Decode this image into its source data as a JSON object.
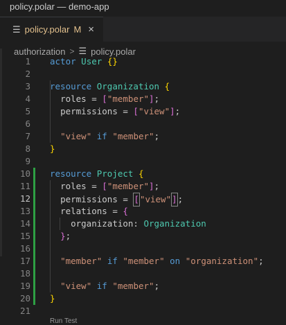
{
  "window": {
    "title": "policy.polar — demo-app"
  },
  "tab": {
    "filename": "policy.polar",
    "modified": "M",
    "close": "×"
  },
  "breadcrumb": {
    "folder": "authorization",
    "file": "policy.polar"
  },
  "editor": {
    "active_line": 12,
    "line_numbers": [
      "1",
      "2",
      "3",
      "4",
      "5",
      "6",
      "7",
      "8",
      "9",
      "10",
      "11",
      "12",
      "13",
      "14",
      "15",
      "16",
      "17",
      "18",
      "19",
      "20",
      "21"
    ],
    "lines": {
      "l1": {
        "kw": "actor",
        "ty": "User",
        "br": "{}"
      },
      "l3": {
        "kw": "resource",
        "ty": "Organization",
        "br": "{"
      },
      "l4": {
        "t1": "roles = ",
        "b1": "[",
        "s1": "\"member\"",
        "b2": "]",
        "t2": ";"
      },
      "l5": {
        "t1": "permissions = ",
        "b1": "[",
        "s1": "\"view\"",
        "b2": "]",
        "t2": ";"
      },
      "l7": {
        "s1": "\"view\"",
        "kw": "if",
        "s2": "\"member\"",
        "t2": ";"
      },
      "l8": {
        "br": "}"
      },
      "l10": {
        "kw": "resource",
        "ty": "Project",
        "br": "{"
      },
      "l11": {
        "t1": "roles = ",
        "b1": "[",
        "s1": "\"member\"",
        "b2": "]",
        "t2": ";"
      },
      "l12": {
        "t1": "permissions = ",
        "b1": "[",
        "s1": "\"view\"",
        "b2": "]",
        "t2": ";"
      },
      "l13": {
        "t1": "relations = ",
        "b1": "{"
      },
      "l14": {
        "t1": "organization: ",
        "ty": "Organization"
      },
      "l15": {
        "b1": "}",
        "t2": ";"
      },
      "l17": {
        "s1": "\"member\"",
        "kw1": "if",
        "s2": "\"member\"",
        "kw2": "on",
        "s3": "\"organization\"",
        "t2": ";"
      },
      "l19": {
        "s1": "\"view\"",
        "kw": "if",
        "s2": "\"member\"",
        "t2": ";"
      },
      "l20": {
        "br": "}"
      }
    },
    "codelens": "Run Test"
  }
}
